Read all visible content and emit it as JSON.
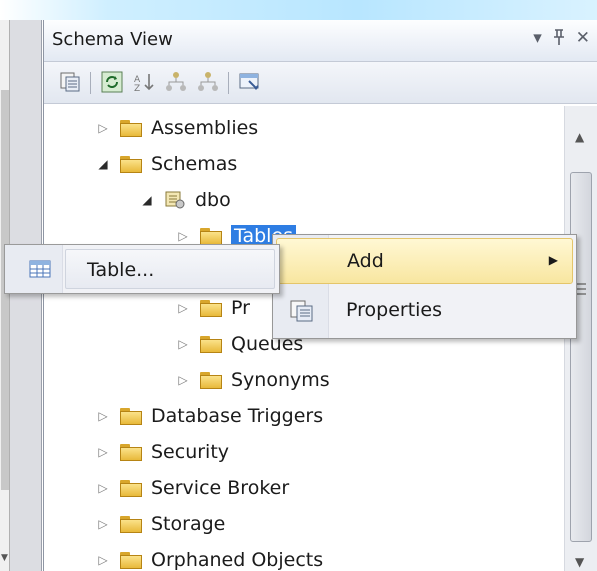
{
  "panel": {
    "title": "Schema View",
    "controls": {
      "dropdown": "▾",
      "pin": "ᛒ",
      "close": "✕"
    }
  },
  "toolbar": {
    "buttons": [
      "properties-icon",
      "refresh-icon",
      "sort-icon",
      "schema-icon-1",
      "schema-icon-2",
      "filter-icon"
    ]
  },
  "tree": {
    "items": [
      {
        "label": "Assemblies",
        "level": 0,
        "expanded": false
      },
      {
        "label": "Schemas",
        "level": 0,
        "expanded": true
      },
      {
        "label": "dbo",
        "level": 1,
        "expanded": true
      },
      {
        "label": "Tables",
        "level": 2,
        "expanded": false,
        "selected": true
      },
      {
        "label": "Pr",
        "level": 2,
        "expanded": false
      },
      {
        "label": "Queues",
        "level": 2,
        "expanded": false
      },
      {
        "label": "Synonyms",
        "level": 2,
        "expanded": false
      },
      {
        "label": "Database Triggers",
        "level": 0,
        "expanded": false
      },
      {
        "label": "Security",
        "level": 0,
        "expanded": false
      },
      {
        "label": "Service Broker",
        "level": 0,
        "expanded": false
      },
      {
        "label": "Storage",
        "level": 0,
        "expanded": false
      },
      {
        "label": "Orphaned Objects",
        "level": 0,
        "expanded": false
      }
    ],
    "partial_label": "Tables"
  },
  "context_menu": {
    "items": [
      {
        "label": "Add",
        "has_submenu": true,
        "highlighted": true
      },
      {
        "label": "Properties",
        "has_submenu": false
      }
    ]
  },
  "submenu": {
    "items": [
      {
        "label": "Table..."
      }
    ]
  },
  "colors": {
    "selection": "#2e7de3",
    "highlight": "#f8e6a0",
    "folder": "#e8b93a"
  }
}
